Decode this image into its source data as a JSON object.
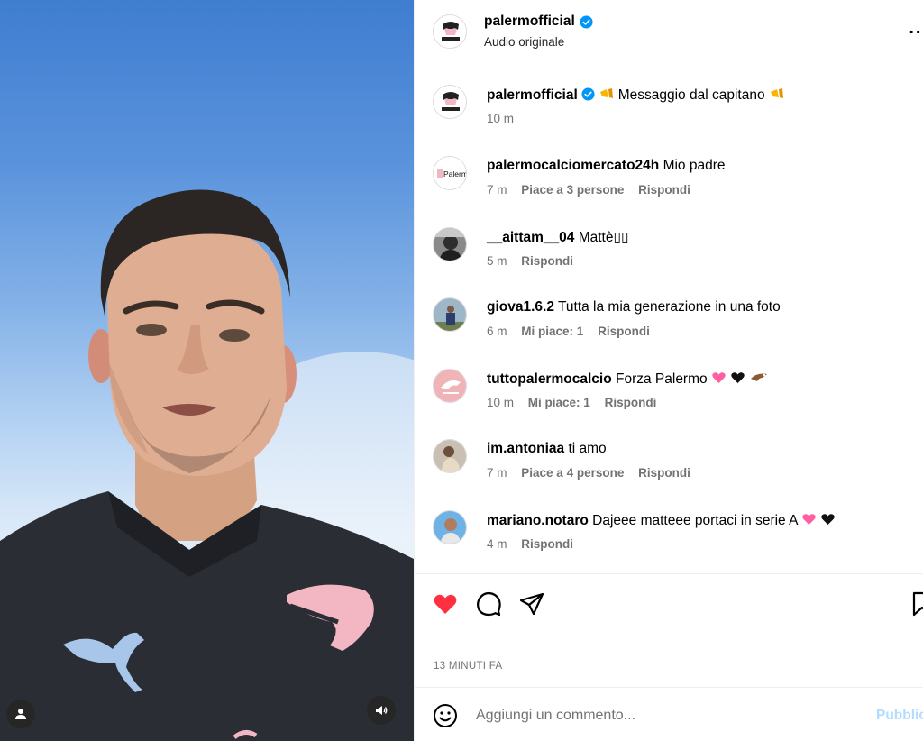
{
  "media": {
    "mute_icon": "speaker-icon",
    "tagged_users_icon": "user-icon"
  },
  "header": {
    "username": "palermofficial",
    "verified": true,
    "subtitle": "Audio originale",
    "more_label": "..."
  },
  "caption": {
    "username": "palermofficial",
    "text": "Messaggio dal capitano",
    "emoji": "megaphone-icon",
    "time": "10 m"
  },
  "comments": [
    {
      "username": "palermocalciomercato24h",
      "text": "Mio padre",
      "time": "7 m",
      "likes": "Piace a 3 persone",
      "reply": "Rispondi",
      "avatar_logo": "Palermo"
    },
    {
      "username": "__aittam__04",
      "text": "Mattè▯▯",
      "time": "5 m",
      "likes": "",
      "reply": "Rispondi"
    },
    {
      "username": "giova1.6.2",
      "text": "Tutta la mia generazione in una foto",
      "time": "6 m",
      "likes": "Mi piace: 1",
      "reply": "Rispondi"
    },
    {
      "username": "tuttopalermocalcio",
      "text": "Forza Palermo",
      "time": "10 m",
      "likes": "Mi piace: 1",
      "reply": "Rispondi",
      "emojis": [
        "pink-heart-icon",
        "black-heart-icon",
        "eagle-icon"
      ]
    },
    {
      "username": "im.antoniaa",
      "text": "ti amo",
      "time": "7 m",
      "likes": "Piace a 4 persone",
      "reply": "Rispondi"
    },
    {
      "username": "mariano.notaro",
      "text": "Dajeee matteee portaci in serie A",
      "time": "4 m",
      "likes": "",
      "reply": "Rispondi",
      "emojis": [
        "pink-heart-icon",
        "black-heart-icon"
      ]
    }
  ],
  "actions": {
    "liked": true,
    "like_color": "#ff3040",
    "timestamp": "13 MINUTI FA"
  },
  "composer": {
    "placeholder": "Aggiungi un commento...",
    "post_label": "Pubblica",
    "post_color": "#b3dbff"
  }
}
